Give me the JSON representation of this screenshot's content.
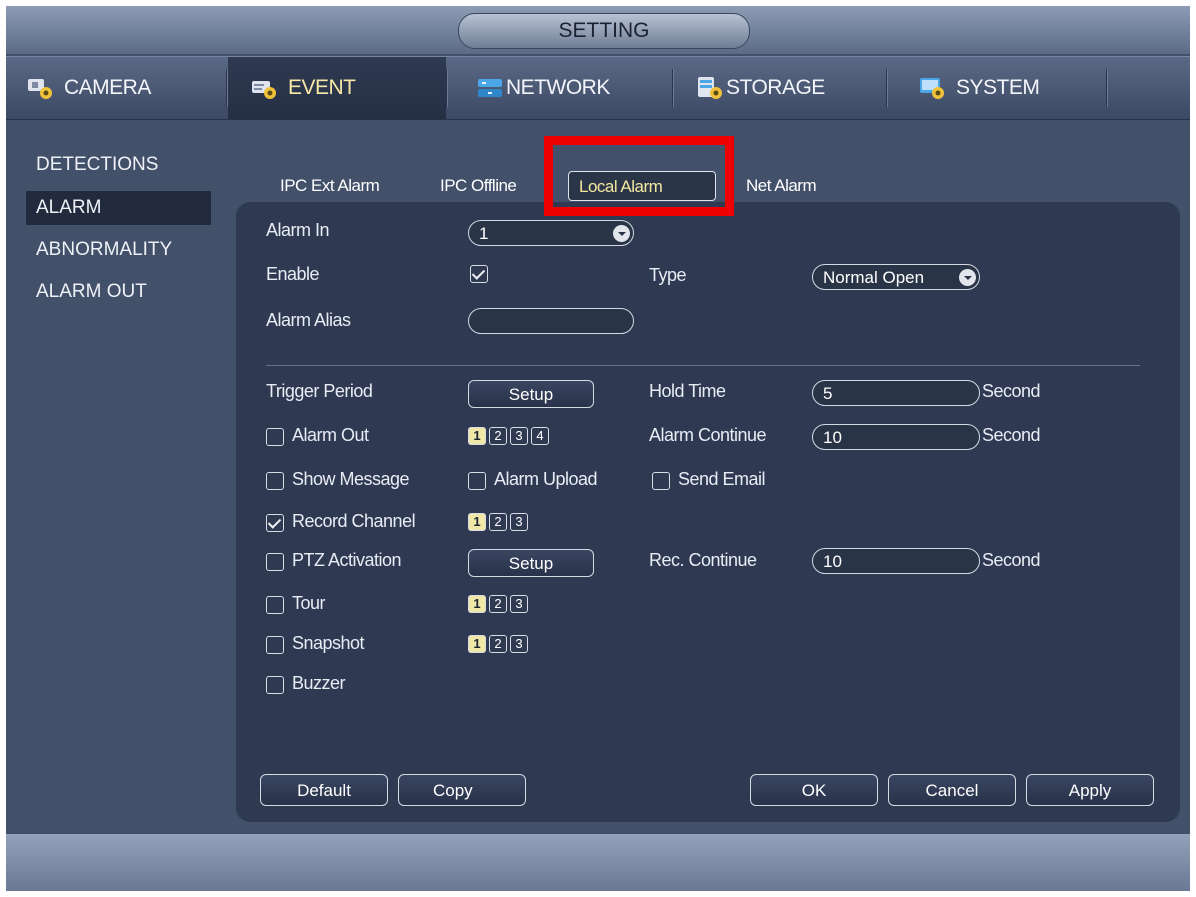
{
  "window": {
    "title": "SETTING"
  },
  "top_tabs": [
    {
      "label": "CAMERA",
      "icon": "camera-gear-icon"
    },
    {
      "label": "EVENT",
      "icon": "event-gear-icon",
      "active": true
    },
    {
      "label": "NETWORK",
      "icon": "network-icon"
    },
    {
      "label": "STORAGE",
      "icon": "storage-gear-icon"
    },
    {
      "label": "SYSTEM",
      "icon": "system-gear-icon"
    }
  ],
  "left_menu": [
    {
      "label": "DETECTIONS"
    },
    {
      "label": "ALARM",
      "active": true
    },
    {
      "label": "ABNORMALITY"
    },
    {
      "label": "ALARM OUT"
    }
  ],
  "sub_tabs": [
    {
      "label": "IPC Ext Alarm"
    },
    {
      "label": "IPC Offline"
    },
    {
      "label": "Local Alarm",
      "active": true
    },
    {
      "label": "Net Alarm"
    }
  ],
  "form": {
    "alarm_in": {
      "label": "Alarm In",
      "value": "1"
    },
    "enable": {
      "label": "Enable",
      "checked": true
    },
    "type": {
      "label": "Type",
      "value": "Normal Open"
    },
    "alarm_alias": {
      "label": "Alarm Alias",
      "value": ""
    },
    "trigger_period": {
      "label": "Trigger Period",
      "button": "Setup"
    },
    "hold_time": {
      "label": "Hold Time",
      "value": "5",
      "unit": "Second"
    },
    "alarm_out": {
      "label": "Alarm Out",
      "checked": false,
      "channels": [
        "1",
        "2",
        "3",
        "4"
      ],
      "selected": [
        "1"
      ]
    },
    "alarm_continue": {
      "label": "Alarm Continue",
      "value": "10",
      "unit": "Second"
    },
    "show_message": {
      "label": "Show Message",
      "checked": false
    },
    "alarm_upload": {
      "label": "Alarm Upload",
      "checked": false
    },
    "send_email": {
      "label": "Send Email",
      "checked": false
    },
    "record_channel": {
      "label": "Record Channel",
      "checked": true,
      "channels": [
        "1",
        "2",
        "3"
      ],
      "selected": [
        "1"
      ]
    },
    "ptz_activation": {
      "label": "PTZ Activation",
      "checked": false,
      "button": "Setup"
    },
    "rec_continue": {
      "label": "Rec. Continue",
      "value": "10",
      "unit": "Second"
    },
    "tour": {
      "label": "Tour",
      "checked": false,
      "channels": [
        "1",
        "2",
        "3"
      ],
      "selected": [
        "1"
      ]
    },
    "snapshot": {
      "label": "Snapshot",
      "checked": false,
      "channels": [
        "1",
        "2",
        "3"
      ],
      "selected": [
        "1"
      ]
    },
    "buzzer": {
      "label": "Buzzer",
      "checked": false
    }
  },
  "buttons": {
    "default": "Default",
    "copy": "Copy",
    "ok": "OK",
    "cancel": "Cancel",
    "apply": "Apply"
  },
  "colors": {
    "highlight_box": "#ee0000",
    "active_text": "#f6e9a8",
    "panel": "#2f3a52"
  }
}
